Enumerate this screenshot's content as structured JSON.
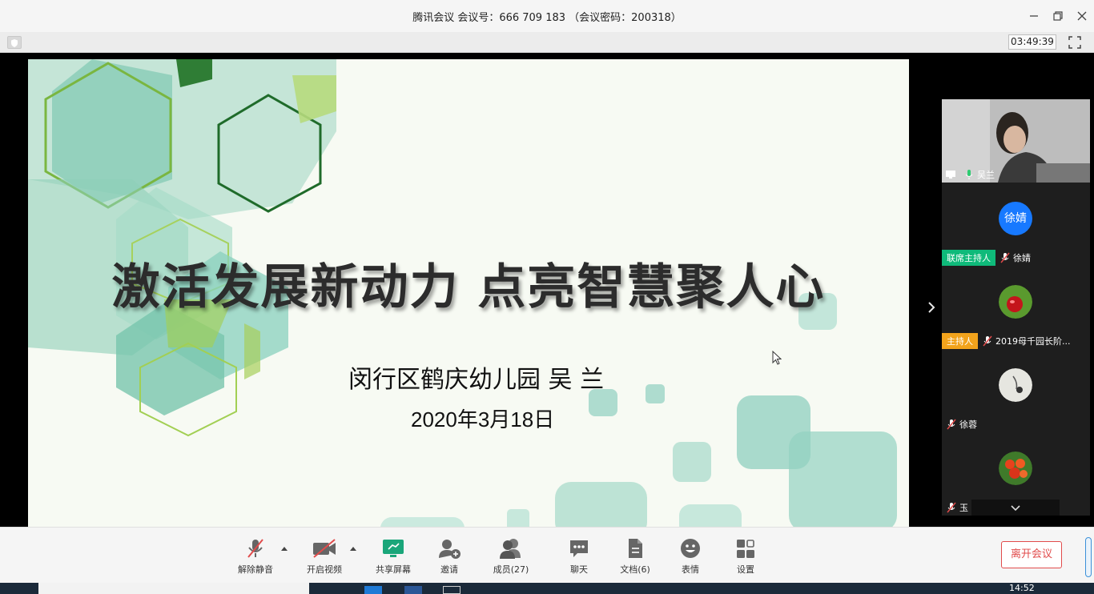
{
  "window": {
    "title": "腾讯会议 会议号：666 709 183 （会议密码：200318）",
    "minimize_icon": "minimize-icon",
    "restore_icon": "restore-icon",
    "close_icon": "close-icon"
  },
  "infobar": {
    "elapsed": "03:49:39"
  },
  "slide": {
    "title": "激活发展新动力  点亮智慧聚人心",
    "author": "闵行区鹤庆幼儿园 吴 兰",
    "date": "2020年3月18日"
  },
  "participants": [
    {
      "name": "吴兰",
      "type": "video",
      "role": ""
    },
    {
      "name": "徐婧",
      "type": "initials",
      "initials": "徐婧",
      "role": "联席主持人"
    },
    {
      "name": "2019母千园长阶...",
      "type": "photo",
      "role": "主持人"
    },
    {
      "name": "徐蓉",
      "type": "photo",
      "role": ""
    },
    {
      "name": "玉",
      "type": "photo",
      "role": ""
    }
  ],
  "toolbar": {
    "mute_label": "解除静音",
    "video_label": "开启视频",
    "share_label": "共享屏幕",
    "invite_label": "邀请",
    "members_label": "成员(27)",
    "chat_label": "聊天",
    "docs_label": "文档(6)",
    "reaction_label": "表情",
    "settings_label": "设置",
    "leave_label": "离开会议"
  },
  "taskbar": {
    "time": "14:52"
  },
  "colors": {
    "accent_blue": "#1779ff",
    "cohost_green": "#0fba7a",
    "host_orange": "#f2a31c",
    "leave_red": "#e14b4b",
    "share_green": "#1aa67a"
  }
}
